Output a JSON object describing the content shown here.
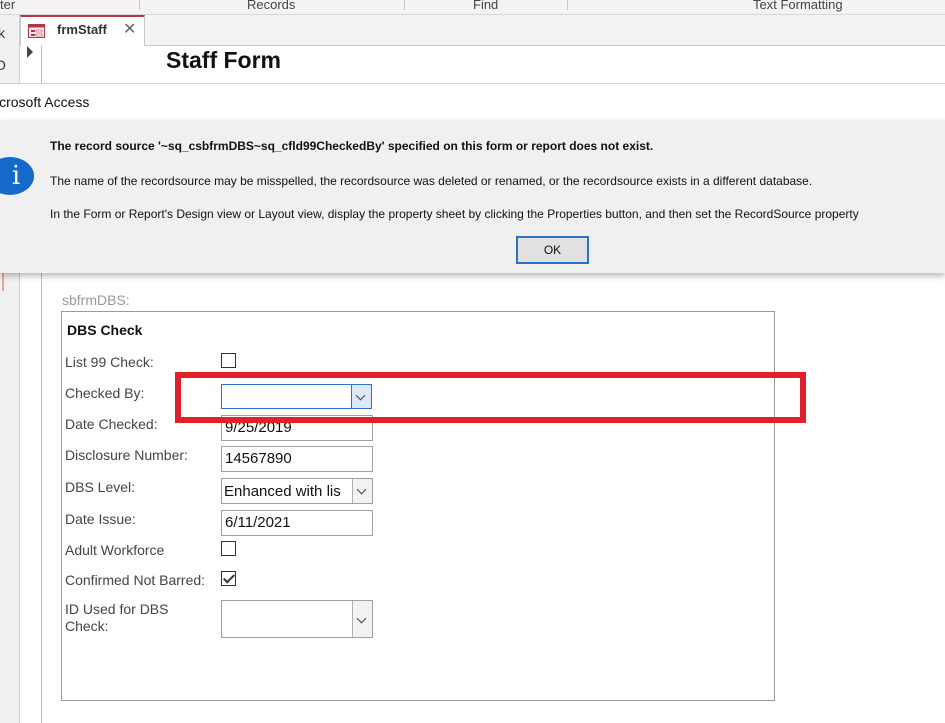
{
  "ribbon": {
    "groups": [
      "ter",
      "Records",
      "Find",
      "Text Formatting"
    ]
  },
  "left_strip": {
    "glyph_top": "k",
    "glyph_search": "O"
  },
  "document_tab": {
    "label": "frmStaff",
    "close_glyph": "✕",
    "icon": "form-icon"
  },
  "form": {
    "title": "Staff Form"
  },
  "dialog": {
    "title": "icrosoft Access",
    "icon": "info-icon",
    "icon_glyph": "i",
    "message_bold": "The record source '~sq_csbfrmDBS~sq_cfld99CheckedBy' specified on this form or report does not exist.",
    "message_line2": "The name of the recordsource may be misspelled, the recordsource was deleted or renamed, or the recordsource exists in a different database.",
    "message_line3": "In the Form or Report's Design view or Layout view, display the property sheet by clicking the Properties button, and then set the RecordSource property",
    "ok_label": "OK",
    "accent_color": "#1469c9"
  },
  "subform": {
    "label": "sbfrmDBS:",
    "heading": "DBS Check",
    "fields": {
      "list99": {
        "label": "List 99 Check:",
        "checked": false
      },
      "checked_by": {
        "label": "Checked By:",
        "value": ""
      },
      "date_checked": {
        "label": "Date Checked:",
        "value": "9/25/2019"
      },
      "disclosure_number": {
        "label": "Disclosure Number:",
        "value": "14567890"
      },
      "dbs_level": {
        "label": "DBS Level:",
        "value": "Enhanced with lis"
      },
      "date_issue": {
        "label": "Date Issue:",
        "value": "6/11/2021"
      },
      "adult_workforce": {
        "label": "Adult Workforce",
        "checked": false
      },
      "confirmed_not_barred": {
        "label": "Confirmed Not Barred:",
        "checked": true
      },
      "id_used": {
        "label_line1": "ID Used for DBS",
        "label_line2": "Check:",
        "value": ""
      }
    }
  },
  "highlight_color": "#e0202a"
}
